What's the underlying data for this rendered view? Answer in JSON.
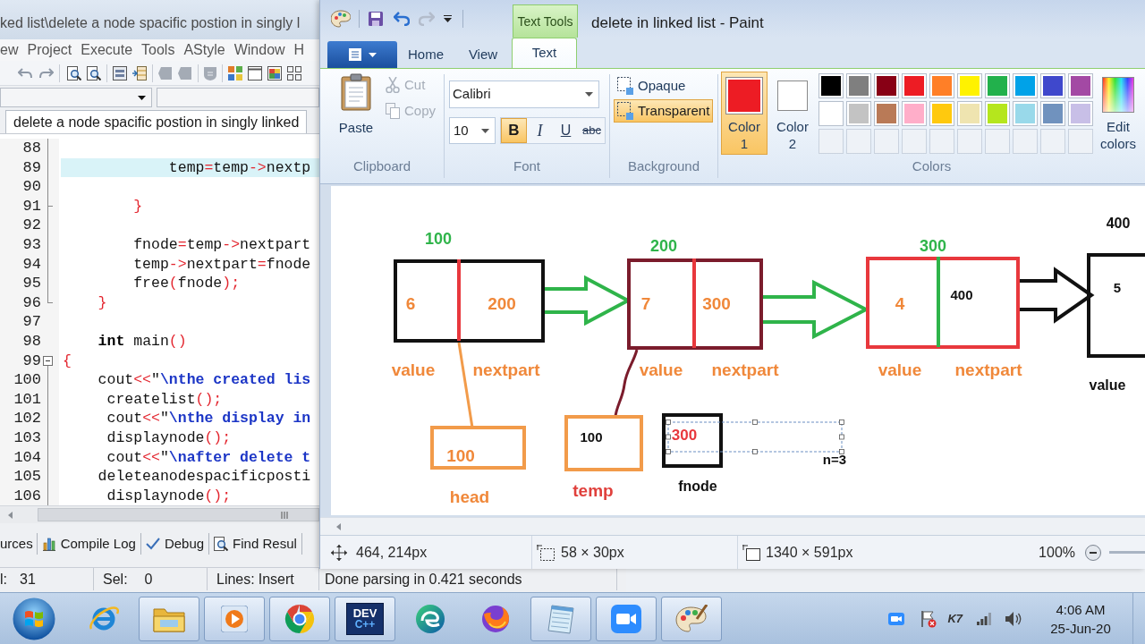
{
  "devcpp": {
    "title": "ked list\\delete a node spacific postion in singly l",
    "menu": [
      "ew",
      "Project",
      "Execute",
      "Tools",
      "AStyle",
      "Window",
      "H"
    ],
    "file_tab": {
      "label": "delete a node spacific postion in singly linked",
      "selected": true
    },
    "code_lines": [
      {
        "number": "88",
        "kind": "fold_line",
        "highlighted": false
      },
      {
        "number": "89",
        "kind": "fold_line",
        "highlighted": true,
        "segments": [
          {
            "text": "            temp",
            "kind": "plain"
          },
          {
            "text": "=",
            "kind": "symbol"
          },
          {
            "text": "temp",
            "kind": "plain"
          },
          {
            "text": "->",
            "kind": "symbol"
          },
          {
            "text": "nextp",
            "kind": "plain"
          }
        ]
      },
      {
        "number": "90",
        "kind": "fold_line",
        "highlighted": false
      },
      {
        "number": "91",
        "kind": "fold_branch",
        "highlighted": false,
        "segments": [
          {
            "text": "        }",
            "kind": "symbol"
          }
        ]
      },
      {
        "number": "92",
        "kind": "fold_line",
        "highlighted": false
      },
      {
        "number": "93",
        "kind": "fold_line",
        "highlighted": false,
        "segments": [
          {
            "text": "        fnode",
            "kind": "plain"
          },
          {
            "text": "=",
            "kind": "symbol"
          },
          {
            "text": "temp",
            "kind": "plain"
          },
          {
            "text": "->",
            "kind": "symbol"
          },
          {
            "text": "nextpart",
            "kind": "plain"
          }
        ]
      },
      {
        "number": "94",
        "kind": "fold_line",
        "highlighted": false,
        "segments": [
          {
            "text": "        temp",
            "kind": "plain"
          },
          {
            "text": "->",
            "kind": "symbol"
          },
          {
            "text": "nextpart",
            "kind": "plain"
          },
          {
            "text": "=",
            "kind": "symbol"
          },
          {
            "text": "fnode",
            "kind": "plain"
          }
        ]
      },
      {
        "number": "95",
        "kind": "fold_line",
        "highlighted": false,
        "segments": [
          {
            "text": "        free",
            "kind": "plain"
          },
          {
            "text": "(",
            "kind": "symbol"
          },
          {
            "text": "fnode",
            "kind": "plain"
          },
          {
            "text": ");",
            "kind": "symbol"
          }
        ]
      },
      {
        "number": "96",
        "kind": "fold_end",
        "highlighted": false,
        "segments": [
          {
            "text": "    }",
            "kind": "symbol"
          }
        ]
      },
      {
        "number": "97",
        "kind": "plain",
        "highlighted": false
      },
      {
        "number": "98",
        "kind": "plain",
        "highlighted": false,
        "segments": [
          {
            "text": "    int",
            "kind": "keyword"
          },
          {
            "text": " main",
            "kind": "plain"
          },
          {
            "text": "()",
            "kind": "symbol"
          }
        ]
      },
      {
        "number": "99",
        "kind": "fold_start",
        "highlighted": false,
        "segments": [
          {
            "text": "{",
            "kind": "symbol"
          }
        ]
      },
      {
        "number": "100",
        "kind": "fold_line",
        "highlighted": false,
        "segments": [
          {
            "text": "    cout",
            "kind": "plain"
          },
          {
            "text": "<<",
            "kind": "symbol"
          },
          {
            "text": "\"",
            "kind": "plain"
          },
          {
            "text": "\\nthe created lis",
            "kind": "string"
          }
        ]
      },
      {
        "number": "101",
        "kind": "fold_line",
        "highlighted": false,
        "segments": [
          {
            "text": "     createlist",
            "kind": "plain"
          },
          {
            "text": "();",
            "kind": "symbol"
          }
        ]
      },
      {
        "number": "102",
        "kind": "fold_line",
        "highlighted": false,
        "segments": [
          {
            "text": "     cout",
            "kind": "plain"
          },
          {
            "text": "<<",
            "kind": "symbol"
          },
          {
            "text": "\"",
            "kind": "plain"
          },
          {
            "text": "\\nthe display in",
            "kind": "string"
          }
        ]
      },
      {
        "number": "103",
        "kind": "fold_line",
        "highlighted": false,
        "segments": [
          {
            "text": "     displaynode",
            "kind": "plain"
          },
          {
            "text": "();",
            "kind": "symbol"
          }
        ]
      },
      {
        "number": "104",
        "kind": "fold_line",
        "highlighted": false,
        "segments": [
          {
            "text": "     cout",
            "kind": "plain"
          },
          {
            "text": "<<",
            "kind": "symbol"
          },
          {
            "text": "\"",
            "kind": "plain"
          },
          {
            "text": "\\nafter delete t",
            "kind": "string"
          }
        ]
      },
      {
        "number": "105",
        "kind": "fold_line",
        "highlighted": false,
        "segments": [
          {
            "text": "    deleteanodespacificposti",
            "kind": "plain"
          }
        ]
      },
      {
        "number": "106",
        "kind": "fold_line",
        "highlighted": false,
        "segments": [
          {
            "text": "     displaynode",
            "kind": "plain"
          },
          {
            "text": "();",
            "kind": "symbol"
          }
        ]
      }
    ],
    "bottom_tabs": [
      {
        "label": "urces",
        "kind": "plain"
      },
      {
        "label": "Compile Log",
        "kind": "log"
      },
      {
        "label": "Debug",
        "kind": "debug"
      },
      {
        "label": "Find Resul",
        "kind": "find"
      }
    ],
    "status": {
      "col_label": "l:",
      "col": "31",
      "sel_label": "Sel:",
      "sel": "0",
      "lines_label": "Lines:",
      "mode": "Insert",
      "message": "Done parsing in 0.421 seconds"
    }
  },
  "paint": {
    "title": "delete in linked list - Paint",
    "contextual_tab": "Text Tools",
    "tabs": [
      {
        "label": "Home",
        "selected": false
      },
      {
        "label": "View",
        "selected": false
      },
      {
        "label": "Text",
        "selected": true
      }
    ],
    "clipboard": {
      "group": "Clipboard",
      "paste": "Paste",
      "actions": [
        {
          "label": "Cut",
          "kind": "cut",
          "disabled": true
        },
        {
          "label": "Copy",
          "kind": "copy",
          "disabled": true
        }
      ]
    },
    "font": {
      "group": "Font",
      "family": "Calibri",
      "size": "10",
      "styles": [
        {
          "label": "B",
          "kind": "bold",
          "selected": true
        },
        {
          "label": "I",
          "kind": "italic",
          "selected": false
        },
        {
          "label": "U",
          "kind": "underline",
          "selected": false
        },
        {
          "label": "abc",
          "kind": "strike",
          "selected": false
        }
      ]
    },
    "background": {
      "group": "Background",
      "options": [
        {
          "label": "Opaque",
          "selected": false
        },
        {
          "label": "Transparent",
          "selected": true
        }
      ]
    },
    "colors": {
      "group": "Colors",
      "slots": [
        {
          "label": "Color 1",
          "color": "#ed1c24",
          "selected": true
        },
        {
          "label": "Color 2",
          "color": "#ffffff",
          "selected": false
        }
      ],
      "palette": [
        {
          "kind": "color",
          "color": "#000000"
        },
        {
          "kind": "color",
          "color": "#7f7f7f"
        },
        {
          "kind": "color",
          "color": "#880015"
        },
        {
          "kind": "color",
          "color": "#ed1c24"
        },
        {
          "kind": "color",
          "color": "#ff7f27"
        },
        {
          "kind": "color",
          "color": "#fff200"
        },
        {
          "kind": "color",
          "color": "#22b14c"
        },
        {
          "kind": "color",
          "color": "#00a2e8"
        },
        {
          "kind": "color",
          "color": "#3f48cc"
        },
        {
          "kind": "color",
          "color": "#a349a4"
        },
        {
          "kind": "color",
          "color": "#ffffff"
        },
        {
          "kind": "color",
          "color": "#c3c3c3"
        },
        {
          "kind": "color",
          "color": "#b97a57"
        },
        {
          "kind": "color",
          "color": "#ffaec9"
        },
        {
          "kind": "color",
          "color": "#ffc90e"
        },
        {
          "kind": "color",
          "color": "#efe4b0"
        },
        {
          "kind": "color",
          "color": "#b5e61d"
        },
        {
          "kind": "color",
          "color": "#99d9ea"
        },
        {
          "kind": "color",
          "color": "#7092be"
        },
        {
          "kind": "color",
          "color": "#c8bfe7"
        },
        {
          "kind": "empty"
        },
        {
          "kind": "empty"
        },
        {
          "kind": "empty"
        },
        {
          "kind": "empty"
        },
        {
          "kind": "empty"
        },
        {
          "kind": "empty"
        },
        {
          "kind": "empty"
        },
        {
          "kind": "empty"
        },
        {
          "kind": "empty"
        },
        {
          "kind": "empty"
        }
      ],
      "edit": "Edit colors"
    },
    "canvas": {
      "nodes": [
        {
          "address": "100",
          "value": "6",
          "next": "200",
          "value_label": "value",
          "next_label": "nextpart",
          "color": "#111111",
          "divider": {
            "color": "#e8383d"
          }
        },
        {
          "address": "200",
          "value": "7",
          "next": "300",
          "value_label": "value",
          "next_label": "nextpart",
          "color": "#7b1c2c",
          "divider": {
            "color": "#e8383d"
          }
        },
        {
          "address": "300",
          "value": "4",
          "next": "400",
          "value_label": "value",
          "next_label": "nextpart",
          "color": "#e8383d",
          "divider": {
            "color": "#2fb44a"
          }
        },
        {
          "address": "400",
          "value": "5",
          "value_label": "value",
          "color": "#111111"
        }
      ],
      "links": [
        {
          "color": "#2fb44a"
        },
        {
          "color": "#2fb44a"
        },
        {
          "color": "#111111"
        }
      ],
      "pointers": [
        {
          "name": "head",
          "value": "100",
          "color": "#f29b4a",
          "editing": false
        },
        {
          "name": "temp",
          "value": "100",
          "color": "#f29b4a",
          "editing": false
        },
        {
          "name": "fnode",
          "value": "300",
          "color": "#111111",
          "editing": true
        }
      ],
      "note": "n=3"
    },
    "status": {
      "cursor": "464, 214px",
      "selection": "58 × 30px",
      "size": "1340 × 591px",
      "zoom": "100%"
    }
  },
  "taskbar": {
    "apps": [
      {
        "kind": "ie",
        "running": false
      },
      {
        "kind": "explorer",
        "running": true
      },
      {
        "kind": "media",
        "running": true
      },
      {
        "kind": "chrome",
        "running": true
      },
      {
        "kind": "devcpp",
        "running": true,
        "logo": [
          "DEV",
          "C++"
        ]
      },
      {
        "kind": "edge",
        "running": false
      },
      {
        "kind": "firefox",
        "running": false
      },
      {
        "kind": "notepad",
        "running": true
      },
      {
        "kind": "zoom",
        "running": true
      },
      {
        "kind": "paint",
        "running": true
      }
    ],
    "tray_badge": "K7",
    "time": "4:06 AM",
    "date": "25-Jun-20"
  }
}
